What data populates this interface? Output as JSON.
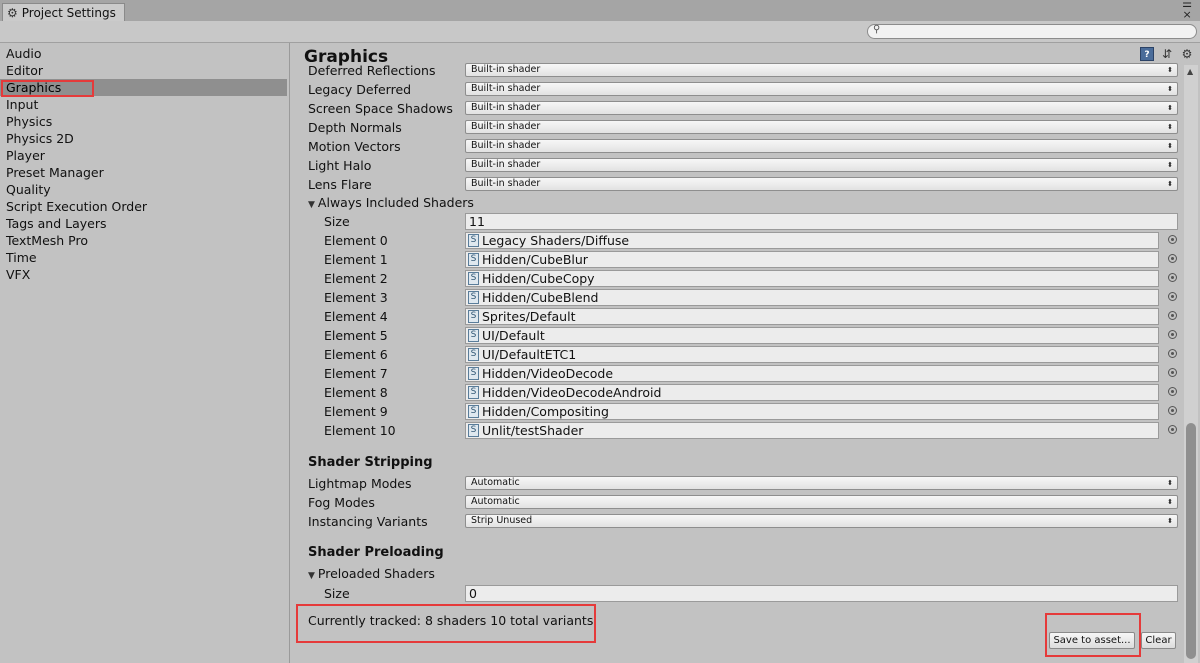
{
  "window": {
    "tab_title": "Project Settings",
    "tab_icon": "gear-icon",
    "menu_glyph": "☰",
    "close_glyph": "×"
  },
  "search": {
    "placeholder": "",
    "icon": "search-icon"
  },
  "sidebar": {
    "items": [
      {
        "label": "Audio"
      },
      {
        "label": "Editor"
      },
      {
        "label": "Graphics",
        "selected": true
      },
      {
        "label": "Input"
      },
      {
        "label": "Physics"
      },
      {
        "label": "Physics 2D"
      },
      {
        "label": "Player"
      },
      {
        "label": "Preset Manager"
      },
      {
        "label": "Quality"
      },
      {
        "label": "Script Execution Order"
      },
      {
        "label": "Tags and Layers"
      },
      {
        "label": "TextMesh Pro"
      },
      {
        "label": "Time"
      },
      {
        "label": "VFX"
      }
    ]
  },
  "main": {
    "title": "Graphics",
    "header_icons": [
      "help-book-icon",
      "preset-sliders-icon",
      "settings-gear-icon"
    ],
    "shader_settings": [
      {
        "label": "Deferred Reflections",
        "value": "Built-in shader"
      },
      {
        "label": "Legacy Deferred",
        "value": "Built-in shader"
      },
      {
        "label": "Screen Space Shadows",
        "value": "Built-in shader"
      },
      {
        "label": "Depth Normals",
        "value": "Built-in shader"
      },
      {
        "label": "Motion Vectors",
        "value": "Built-in shader"
      },
      {
        "label": "Light Halo",
        "value": "Built-in shader"
      },
      {
        "label": "Lens Flare",
        "value": "Built-in shader"
      }
    ],
    "always_included": {
      "label": "Always Included Shaders",
      "size_label": "Size",
      "size": "11",
      "elements": [
        {
          "label": "Element 0",
          "value": "Legacy Shaders/Diffuse"
        },
        {
          "label": "Element 1",
          "value": "Hidden/CubeBlur"
        },
        {
          "label": "Element 2",
          "value": "Hidden/CubeCopy"
        },
        {
          "label": "Element 3",
          "value": "Hidden/CubeBlend"
        },
        {
          "label": "Element 4",
          "value": "Sprites/Default"
        },
        {
          "label": "Element 5",
          "value": "UI/Default"
        },
        {
          "label": "Element 6",
          "value": "UI/DefaultETC1"
        },
        {
          "label": "Element 7",
          "value": "Hidden/VideoDecode"
        },
        {
          "label": "Element 8",
          "value": "Hidden/VideoDecodeAndroid"
        },
        {
          "label": "Element 9",
          "value": "Hidden/Compositing"
        },
        {
          "label": "Element 10",
          "value": "Unlit/testShader"
        }
      ]
    },
    "stripping": {
      "title": "Shader Stripping",
      "rows": [
        {
          "label": "Lightmap Modes",
          "value": "Automatic"
        },
        {
          "label": "Fog Modes",
          "value": "Automatic"
        },
        {
          "label": "Instancing Variants",
          "value": "Strip Unused"
        }
      ]
    },
    "preloading": {
      "title": "Shader Preloading",
      "preloaded_label": "Preloaded Shaders",
      "size_label": "Size",
      "size": "0"
    },
    "tracked_text": "Currently tracked: 8 shaders 10 total variants",
    "save_button": "Save to asset...",
    "clear_button": "Clear"
  },
  "colors": {
    "background": "#c2c2c2",
    "selected_item": "#8f8f8f",
    "highlight_box": "#e53a3a"
  }
}
